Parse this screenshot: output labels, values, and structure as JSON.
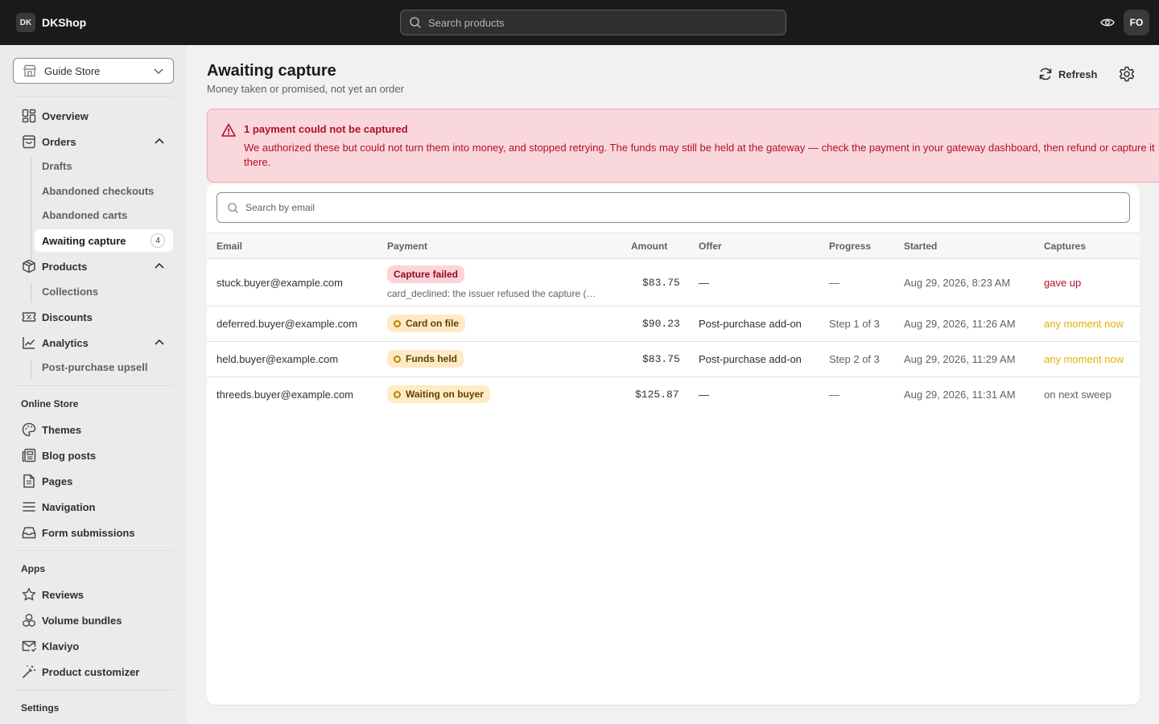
{
  "topbar": {
    "logo": "DK",
    "brand": "DKShop",
    "search_placeholder": "Search products",
    "avatar": "FO",
    "icons": [
      "search-icon",
      "eye-icon"
    ]
  },
  "sidebar": {
    "store": "Guide Store",
    "nav": {
      "overview": "Overview",
      "orders": "Orders",
      "drafts": "Drafts",
      "abandoned_checkouts": "Abandoned checkouts",
      "abandoned_carts": "Abandoned carts",
      "awaiting_capture": "Awaiting capture",
      "awaiting_capture_count": "4",
      "products": "Products",
      "collections": "Collections",
      "discounts": "Discounts",
      "analytics": "Analytics",
      "post_purchase_upsell": "Post-purchase upsell"
    },
    "online_store": {
      "heading": "Online Store",
      "themes": "Themes",
      "blog_posts": "Blog posts",
      "pages": "Pages",
      "navigation": "Navigation",
      "form_submissions": "Form submissions"
    },
    "apps": {
      "heading": "Apps",
      "reviews": "Reviews",
      "volume_bundles": "Volume bundles",
      "klaviyo": "Klaviyo",
      "product_customizer": "Product customizer"
    },
    "settings_heading": "Settings"
  },
  "header": {
    "title": "Awaiting capture",
    "subtitle": "Money taken or promised, not yet an order",
    "refresh": "Refresh"
  },
  "alert": {
    "title": "1 payment could not be captured",
    "body": "We authorized these but could not turn them into money, and stopped retrying. The funds may still be held at the gateway — check the payment in your gateway dashboard, then refund or capture it there."
  },
  "table": {
    "search_placeholder": "Search by email",
    "columns": {
      "email": "Email",
      "payment": "Payment",
      "amount": "Amount",
      "offer": "Offer",
      "progress": "Progress",
      "started": "Started",
      "captures": "Captures"
    },
    "rows": [
      {
        "email": "stuck.buyer@example.com",
        "payment": "Capture failed",
        "error": "card_declined: the issuer refused the capture (…",
        "amount": "$83.75",
        "offer": "—",
        "progress": "—",
        "started": "Aug 29, 2026, 8:23 AM",
        "captures": "gave up"
      },
      {
        "email": "deferred.buyer@example.com",
        "payment": "Card on file",
        "amount": "$90.23",
        "offer": "Post-purchase add-on",
        "progress": "Step 1 of 3",
        "started": "Aug 29, 2026, 11:26 AM",
        "captures": "any moment now"
      },
      {
        "email": "held.buyer@example.com",
        "payment": "Funds held",
        "amount": "$83.75",
        "offer": "Post-purchase add-on",
        "progress": "Step 2 of 3",
        "started": "Aug 29, 2026, 11:29 AM",
        "captures": "any moment now"
      },
      {
        "email": "threeds.buyer@example.com",
        "payment": "Waiting on buyer",
        "amount": "$125.87",
        "offer": "—",
        "progress": "—",
        "started": "Aug 29, 2026, 11:31 AM",
        "captures": "on next sweep"
      }
    ]
  },
  "colors": {
    "danger": "#b0102a",
    "warning_text": "#e1b000",
    "topbar": "#1a1a1a"
  }
}
